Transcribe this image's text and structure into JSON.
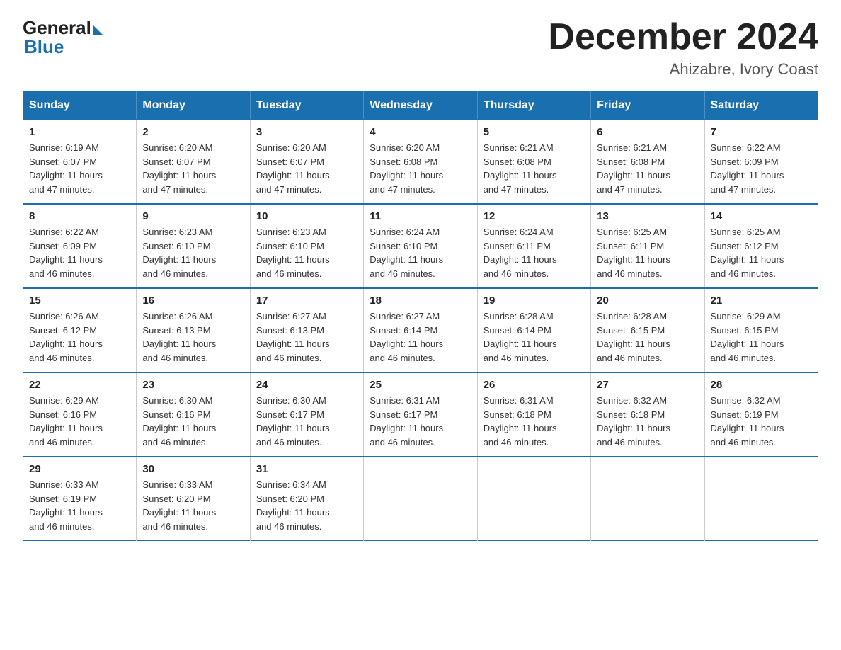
{
  "logo": {
    "general": "General",
    "blue": "Blue"
  },
  "title": "December 2024",
  "location": "Ahizabre, Ivory Coast",
  "weekdays": [
    "Sunday",
    "Monday",
    "Tuesday",
    "Wednesday",
    "Thursday",
    "Friday",
    "Saturday"
  ],
  "weeks": [
    [
      {
        "day": 1,
        "sunrise": "6:19 AM",
        "sunset": "6:07 PM",
        "daylight": "11 hours and 47 minutes."
      },
      {
        "day": 2,
        "sunrise": "6:20 AM",
        "sunset": "6:07 PM",
        "daylight": "11 hours and 47 minutes."
      },
      {
        "day": 3,
        "sunrise": "6:20 AM",
        "sunset": "6:07 PM",
        "daylight": "11 hours and 47 minutes."
      },
      {
        "day": 4,
        "sunrise": "6:20 AM",
        "sunset": "6:08 PM",
        "daylight": "11 hours and 47 minutes."
      },
      {
        "day": 5,
        "sunrise": "6:21 AM",
        "sunset": "6:08 PM",
        "daylight": "11 hours and 47 minutes."
      },
      {
        "day": 6,
        "sunrise": "6:21 AM",
        "sunset": "6:08 PM",
        "daylight": "11 hours and 47 minutes."
      },
      {
        "day": 7,
        "sunrise": "6:22 AM",
        "sunset": "6:09 PM",
        "daylight": "11 hours and 47 minutes."
      }
    ],
    [
      {
        "day": 8,
        "sunrise": "6:22 AM",
        "sunset": "6:09 PM",
        "daylight": "11 hours and 46 minutes."
      },
      {
        "day": 9,
        "sunrise": "6:23 AM",
        "sunset": "6:10 PM",
        "daylight": "11 hours and 46 minutes."
      },
      {
        "day": 10,
        "sunrise": "6:23 AM",
        "sunset": "6:10 PM",
        "daylight": "11 hours and 46 minutes."
      },
      {
        "day": 11,
        "sunrise": "6:24 AM",
        "sunset": "6:10 PM",
        "daylight": "11 hours and 46 minutes."
      },
      {
        "day": 12,
        "sunrise": "6:24 AM",
        "sunset": "6:11 PM",
        "daylight": "11 hours and 46 minutes."
      },
      {
        "day": 13,
        "sunrise": "6:25 AM",
        "sunset": "6:11 PM",
        "daylight": "11 hours and 46 minutes."
      },
      {
        "day": 14,
        "sunrise": "6:25 AM",
        "sunset": "6:12 PM",
        "daylight": "11 hours and 46 minutes."
      }
    ],
    [
      {
        "day": 15,
        "sunrise": "6:26 AM",
        "sunset": "6:12 PM",
        "daylight": "11 hours and 46 minutes."
      },
      {
        "day": 16,
        "sunrise": "6:26 AM",
        "sunset": "6:13 PM",
        "daylight": "11 hours and 46 minutes."
      },
      {
        "day": 17,
        "sunrise": "6:27 AM",
        "sunset": "6:13 PM",
        "daylight": "11 hours and 46 minutes."
      },
      {
        "day": 18,
        "sunrise": "6:27 AM",
        "sunset": "6:14 PM",
        "daylight": "11 hours and 46 minutes."
      },
      {
        "day": 19,
        "sunrise": "6:28 AM",
        "sunset": "6:14 PM",
        "daylight": "11 hours and 46 minutes."
      },
      {
        "day": 20,
        "sunrise": "6:28 AM",
        "sunset": "6:15 PM",
        "daylight": "11 hours and 46 minutes."
      },
      {
        "day": 21,
        "sunrise": "6:29 AM",
        "sunset": "6:15 PM",
        "daylight": "11 hours and 46 minutes."
      }
    ],
    [
      {
        "day": 22,
        "sunrise": "6:29 AM",
        "sunset": "6:16 PM",
        "daylight": "11 hours and 46 minutes."
      },
      {
        "day": 23,
        "sunrise": "6:30 AM",
        "sunset": "6:16 PM",
        "daylight": "11 hours and 46 minutes."
      },
      {
        "day": 24,
        "sunrise": "6:30 AM",
        "sunset": "6:17 PM",
        "daylight": "11 hours and 46 minutes."
      },
      {
        "day": 25,
        "sunrise": "6:31 AM",
        "sunset": "6:17 PM",
        "daylight": "11 hours and 46 minutes."
      },
      {
        "day": 26,
        "sunrise": "6:31 AM",
        "sunset": "6:18 PM",
        "daylight": "11 hours and 46 minutes."
      },
      {
        "day": 27,
        "sunrise": "6:32 AM",
        "sunset": "6:18 PM",
        "daylight": "11 hours and 46 minutes."
      },
      {
        "day": 28,
        "sunrise": "6:32 AM",
        "sunset": "6:19 PM",
        "daylight": "11 hours and 46 minutes."
      }
    ],
    [
      {
        "day": 29,
        "sunrise": "6:33 AM",
        "sunset": "6:19 PM",
        "daylight": "11 hours and 46 minutes."
      },
      {
        "day": 30,
        "sunrise": "6:33 AM",
        "sunset": "6:20 PM",
        "daylight": "11 hours and 46 minutes."
      },
      {
        "day": 31,
        "sunrise": "6:34 AM",
        "sunset": "6:20 PM",
        "daylight": "11 hours and 46 minutes."
      },
      null,
      null,
      null,
      null
    ]
  ],
  "labels": {
    "sunrise": "Sunrise:",
    "sunset": "Sunset:",
    "daylight": "Daylight:"
  }
}
